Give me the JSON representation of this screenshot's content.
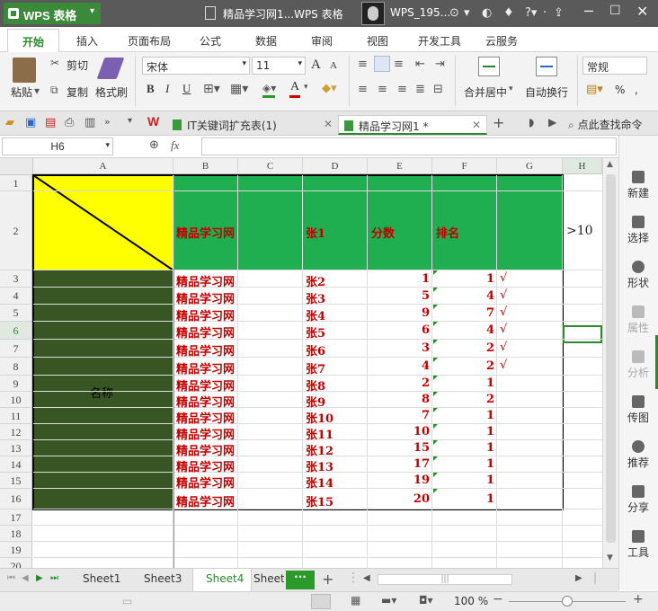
{
  "app": {
    "name": "WPS 表格",
    "doc_title": "精品学习网1...WPS 表格",
    "user": "WPS_195..."
  },
  "menu_tabs": [
    "开始",
    "插入",
    "页面布局",
    "公式",
    "数据",
    "审阅",
    "视图",
    "开发工具",
    "云服务"
  ],
  "ribbon": {
    "paste": "粘贴",
    "cut": "剪切",
    "copy": "复制",
    "format_painter": "格式刷",
    "font_name": "宋体",
    "font_size": "11",
    "grow": "A",
    "shrink": "A",
    "bold": "B",
    "italic": "I",
    "underline": "U",
    "merge_center": "合并居中",
    "wrap": "自动换行",
    "number_format": "常规",
    "percent": "%"
  },
  "doc_tabs": {
    "tab1": "IT关键词扩充表(1)",
    "tab2": "精品学习网1 *",
    "search": "点此查找命令"
  },
  "formula": {
    "name_box": "H6",
    "fx": "fx",
    "value": ""
  },
  "columns": [
    "A",
    "B",
    "C",
    "D",
    "E",
    "F",
    "G",
    "H"
  ],
  "rows": [
    "1",
    "2",
    "3",
    "4",
    "5",
    "6",
    "7",
    "8",
    "9",
    "10",
    "11",
    "12",
    "13",
    "14",
    "15",
    "16",
    "17",
    "18",
    "19",
    "20"
  ],
  "sheet": {
    "header": {
      "b": "精品学习网",
      "d": "张1",
      "e": "分数",
      "f": "排名",
      "h": ">10"
    },
    "merged_a": "名称",
    "data": [
      {
        "b": "精品学习网",
        "d": "张2",
        "e": "1",
        "f": "1",
        "g": "√"
      },
      {
        "b": "精品学习网",
        "d": "张3",
        "e": "5",
        "f": "4",
        "g": "√"
      },
      {
        "b": "精品学习网",
        "d": "张4",
        "e": "9",
        "f": "7",
        "g": "√"
      },
      {
        "b": "精品学习网",
        "d": "张5",
        "e": "6",
        "f": "4",
        "g": "√"
      },
      {
        "b": "精品学习网",
        "d": "张6",
        "e": "3",
        "f": "2",
        "g": "√"
      },
      {
        "b": "精品学习网",
        "d": "张7",
        "e": "4",
        "f": "2",
        "g": "√"
      },
      {
        "b": "精品学习网",
        "d": "张8",
        "e": "2",
        "f": "1",
        "g": ""
      },
      {
        "b": "精品学习网",
        "d": "张9",
        "e": "8",
        "f": "2",
        "g": ""
      },
      {
        "b": "精品学习网",
        "d": "张10",
        "e": "7",
        "f": "1",
        "g": ""
      },
      {
        "b": "精品学习网",
        "d": "张11",
        "e": "10",
        "f": "1",
        "g": ""
      },
      {
        "b": "精品学习网",
        "d": "张12",
        "e": "15",
        "f": "1",
        "g": ""
      },
      {
        "b": "精品学习网",
        "d": "张13",
        "e": "17",
        "f": "1",
        "g": ""
      },
      {
        "b": "精品学习网",
        "d": "张14",
        "e": "19",
        "f": "1",
        "g": ""
      },
      {
        "b": "精品学习网",
        "d": "张15",
        "e": "20",
        "f": "1",
        "g": ""
      }
    ]
  },
  "right_panel": [
    "新建",
    "选择",
    "形状",
    "属性",
    "分析",
    "传图",
    "推荐",
    "分享",
    "工具"
  ],
  "sheet_tabs": [
    "Sheet1",
    "Sheet3",
    "Sheet4",
    "Sheet!"
  ],
  "active_sheet": "Sheet4",
  "status": {
    "zoom": "100 %"
  },
  "colors": {
    "green_fill": "#1fae50",
    "yellow_fill": "#ffff00",
    "dark_fill": "#375623",
    "text_red": "#c00000",
    "brand": "#2a8a2a"
  }
}
